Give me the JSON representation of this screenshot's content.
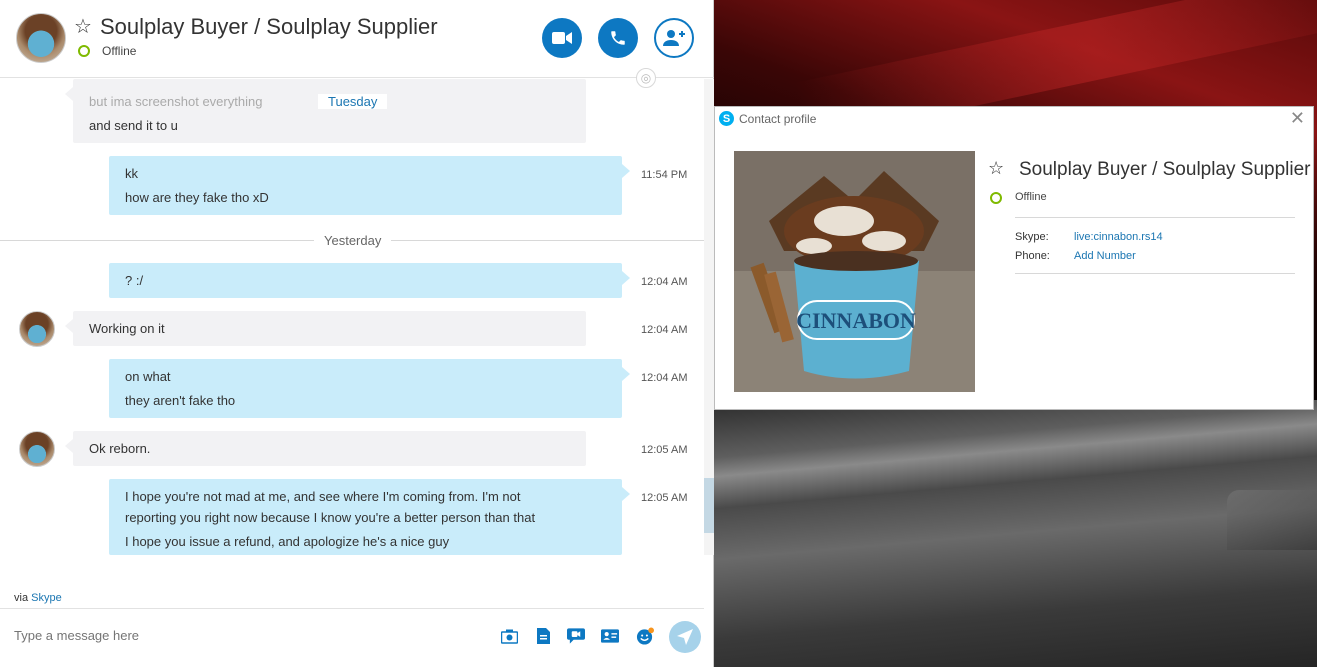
{
  "chat": {
    "contact_name": "Soulplay Buyer / Soulplay Supplier",
    "status": "Offline",
    "video_button": "video-call",
    "call_button": "audio-call",
    "add_button": "add-people"
  },
  "messages": {
    "partial_top_lines": [
      "but ima screenshot everything",
      "and send it to u"
    ],
    "tuesday_label": "Tuesday",
    "msg1": {
      "lines": [
        "kk",
        "how are they fake tho xD"
      ],
      "time": "11:54 PM"
    },
    "yesterday_label": "Yesterday",
    "msg2": {
      "lines": [
        "? :/"
      ],
      "time": "12:04 AM"
    },
    "msg3": {
      "lines": [
        "Working on it"
      ],
      "time": "12:04 AM"
    },
    "msg4": {
      "lines": [
        "on what",
        "they aren't fake tho"
      ],
      "time": "12:04 AM"
    },
    "msg5": {
      "lines": [
        "Ok reborn."
      ],
      "time": "12:05 AM"
    },
    "msg6": {
      "lines": [
        "I hope you're not mad at me, and see where I'm coming from. I'm not",
        "reporting you right now because I know you're a better person than that",
        "I hope you issue a refund, and apologize he's a nice guy"
      ],
      "time": "12:05 AM"
    }
  },
  "footer": {
    "via_prefix": "via",
    "via_link": "Skype",
    "compose_placeholder": "Type a message here"
  },
  "profile": {
    "window_title": "Contact profile",
    "name": "Soulplay Buyer / Soulplay Supplier",
    "status": "Offline",
    "skype_label": "Skype:",
    "skype_value": "live:cinnabon.rs14",
    "phone_label": "Phone:",
    "phone_value": "Add Number",
    "photo_text": "CINNABON"
  },
  "colors": {
    "accent": "#0d78c2",
    "bubble_me": "#c9ecfa",
    "bubble_them": "#f2f2f4",
    "online_ring": "#7fba00",
    "link": "#1b76b2"
  }
}
